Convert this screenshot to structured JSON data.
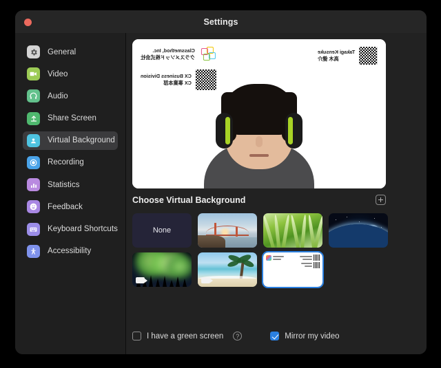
{
  "window": {
    "title": "Settings",
    "close_button": "close-button"
  },
  "sidebar": {
    "items": [
      {
        "id": "general",
        "label": "General",
        "icon": "gear-icon",
        "color": "#d4d4d4",
        "selected": false
      },
      {
        "id": "video",
        "label": "Video",
        "icon": "camera-icon",
        "color": "#9ccb55",
        "selected": false
      },
      {
        "id": "audio",
        "label": "Audio",
        "icon": "headphones-icon",
        "color": "#63c18c",
        "selected": false
      },
      {
        "id": "share-screen",
        "label": "Share Screen",
        "icon": "upload-icon",
        "color": "#4fb86e",
        "selected": false
      },
      {
        "id": "virtual-background",
        "label": "Virtual Background",
        "icon": "person-card-icon",
        "color": "#4ec3e0",
        "selected": true
      },
      {
        "id": "recording",
        "label": "Recording",
        "icon": "record-icon",
        "color": "#4aa3e8",
        "selected": false
      },
      {
        "id": "statistics",
        "label": "Statistics",
        "icon": "bars-icon",
        "color": "#b98ae0",
        "selected": false
      },
      {
        "id": "feedback",
        "label": "Feedback",
        "icon": "smiley-icon",
        "color": "#a887e3",
        "selected": false
      },
      {
        "id": "keyboard-shortcuts",
        "label": "Keyboard Shortcuts",
        "icon": "keyboard-icon",
        "color": "#9b8de8",
        "selected": false
      },
      {
        "id": "accessibility",
        "label": "Accessibility",
        "icon": "accessibility-icon",
        "color": "#7f92ec",
        "selected": false
      }
    ]
  },
  "preview": {
    "mirrored": true,
    "overlay": {
      "company_en": "Classmethod, Inc.",
      "company_jp": "クラスメソッド株式会社",
      "division_en": "CX Business Division",
      "division_jp": "CX 事業本部",
      "person_en": "Takagi Kensuke",
      "person_jp": "高木 健介"
    }
  },
  "section": {
    "title": "Choose Virtual Background",
    "add_button": "plus-icon"
  },
  "backgrounds": [
    {
      "id": "none",
      "label": "None",
      "kind": "none",
      "selected": false,
      "is_video": false
    },
    {
      "id": "bridge",
      "label": "",
      "kind": "bridge",
      "selected": false,
      "is_video": false
    },
    {
      "id": "grass",
      "label": "",
      "kind": "grass",
      "selected": false,
      "is_video": false
    },
    {
      "id": "earth",
      "label": "",
      "kind": "earth",
      "selected": false,
      "is_video": false
    },
    {
      "id": "aurora",
      "label": "",
      "kind": "aurora",
      "selected": false,
      "is_video": true
    },
    {
      "id": "beach",
      "label": "",
      "kind": "beach",
      "selected": false,
      "is_video": true
    },
    {
      "id": "custom-card",
      "label": "",
      "kind": "card",
      "selected": true,
      "is_video": false
    }
  ],
  "footer": {
    "green_screen": {
      "label": "I have a green screen",
      "checked": false,
      "help": "?"
    },
    "mirror_video": {
      "label": "Mirror my video",
      "checked": true
    }
  },
  "colors": {
    "accent": "#2a7fe0",
    "window_bg": "#222222",
    "sidebar_bg": "#1f1f1f",
    "titlebar_bg": "#262626",
    "close": "#ec6a5e",
    "selected_row": "#3b3b3d"
  }
}
